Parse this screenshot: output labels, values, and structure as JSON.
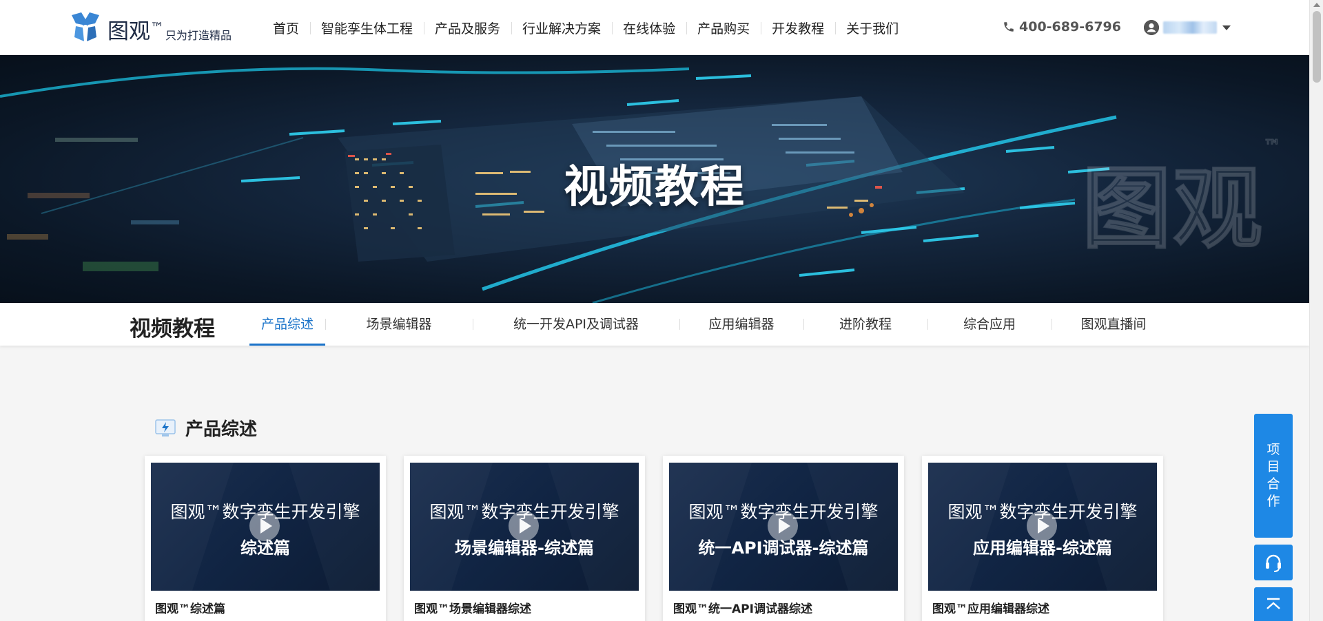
{
  "header": {
    "logo_name": "图观",
    "logo_tm": "™",
    "logo_slogan": "只为打造精品",
    "nav": [
      "首页",
      "智能孪生体工程",
      "产品及服务",
      "行业解决方案",
      "在线体验",
      "产品购买",
      "开发教程",
      "关于我们"
    ],
    "phone": "400-689-6796"
  },
  "banner": {
    "title": "视频教程",
    "watermark": "图观",
    "watermark_tm": "™"
  },
  "subnav": {
    "title": "视频教程",
    "tabs": [
      "产品综述",
      "场景编辑器",
      "统一开发API及调试器",
      "应用编辑器",
      "进阶教程",
      "综合应用",
      "图观直播间"
    ],
    "active_tab": "产品综述"
  },
  "section": {
    "title": "产品综述"
  },
  "cards": [
    {
      "thumb_line1": "图观™数字孪生开发引擎",
      "thumb_line2": "综述篇",
      "title": "图观™综述篇"
    },
    {
      "thumb_line1": "图观™数字孪生开发引擎",
      "thumb_line2": "场景编辑器-综述篇",
      "title": "图观™场景编辑器综述"
    },
    {
      "thumb_line1": "图观™数字孪生开发引擎",
      "thumb_line2": "统一API调试器-综述篇",
      "title": "图观™统一API调试器综述"
    },
    {
      "thumb_line1": "图观™数字孪生开发引擎",
      "thumb_line2": "应用编辑器-综述篇",
      "title": "图观™应用编辑器综述"
    }
  ],
  "float": {
    "coop_chars": [
      "项",
      "目",
      "合",
      "作"
    ]
  },
  "icons": {
    "logo": "tuguan-logo-icon",
    "phone": "phone-icon",
    "user": "user-circle-icon",
    "caret": "caret-down-icon",
    "section": "lightning-monitor-icon",
    "play": "play-icon",
    "support": "headset-icon",
    "top": "back-to-top-icon"
  },
  "colors": {
    "accent": "#1a73c9",
    "float_bg": "#1e88e5",
    "brand_text": "#1d2a44"
  }
}
